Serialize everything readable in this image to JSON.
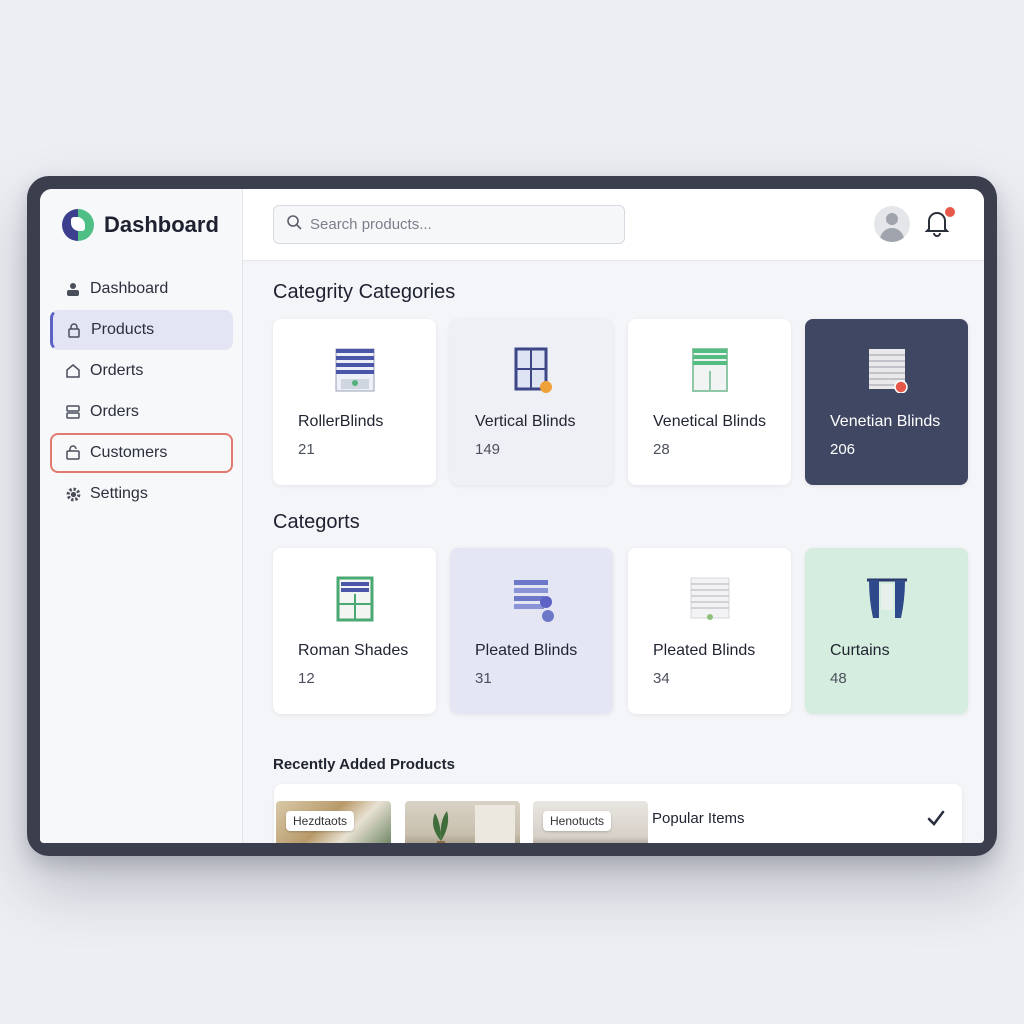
{
  "sidebar": {
    "brand": "Dashboard",
    "items": [
      {
        "label": "Dashboard",
        "icon": "user-icon"
      },
      {
        "label": "Products",
        "icon": "lock-icon"
      },
      {
        "label": "Orderts",
        "icon": "bag-icon"
      },
      {
        "label": "Orders",
        "icon": "server-icon"
      },
      {
        "label": "Customers",
        "icon": "bag-icon"
      },
      {
        "label": "Settings",
        "icon": "gear-icon"
      }
    ]
  },
  "topbar": {
    "search_placeholder": "Search products..."
  },
  "sections": {
    "first_title": "Categrity Categories",
    "second_title": "Categorts"
  },
  "cards_row1": [
    {
      "name": "RollerBlinds",
      "count": "21"
    },
    {
      "name": "Vertical Blinds",
      "count": "149"
    },
    {
      "name": "Venetical Blinds",
      "count": "28"
    },
    {
      "name": "Venetian Blinds",
      "count": "206"
    }
  ],
  "cards_row2": [
    {
      "name": "Roman Shades",
      "count": "12"
    },
    {
      "name": "Pleated Blinds",
      "count": "31"
    },
    {
      "name": "Pleated Blinds",
      "count": "34"
    },
    {
      "name": "Curtains",
      "count": "48"
    }
  ],
  "recent": {
    "title": "Recently Added Products",
    "thumb_tags": [
      "Hezdtaots",
      "Henotucts"
    ],
    "popular_label": "Popular Items"
  },
  "colors": {
    "accent": "#5d62c4",
    "highlight_outline": "#e07a6f",
    "dark_card": "#3f4763",
    "mint_card": "#d5eddf",
    "notification": "#e8584a"
  }
}
